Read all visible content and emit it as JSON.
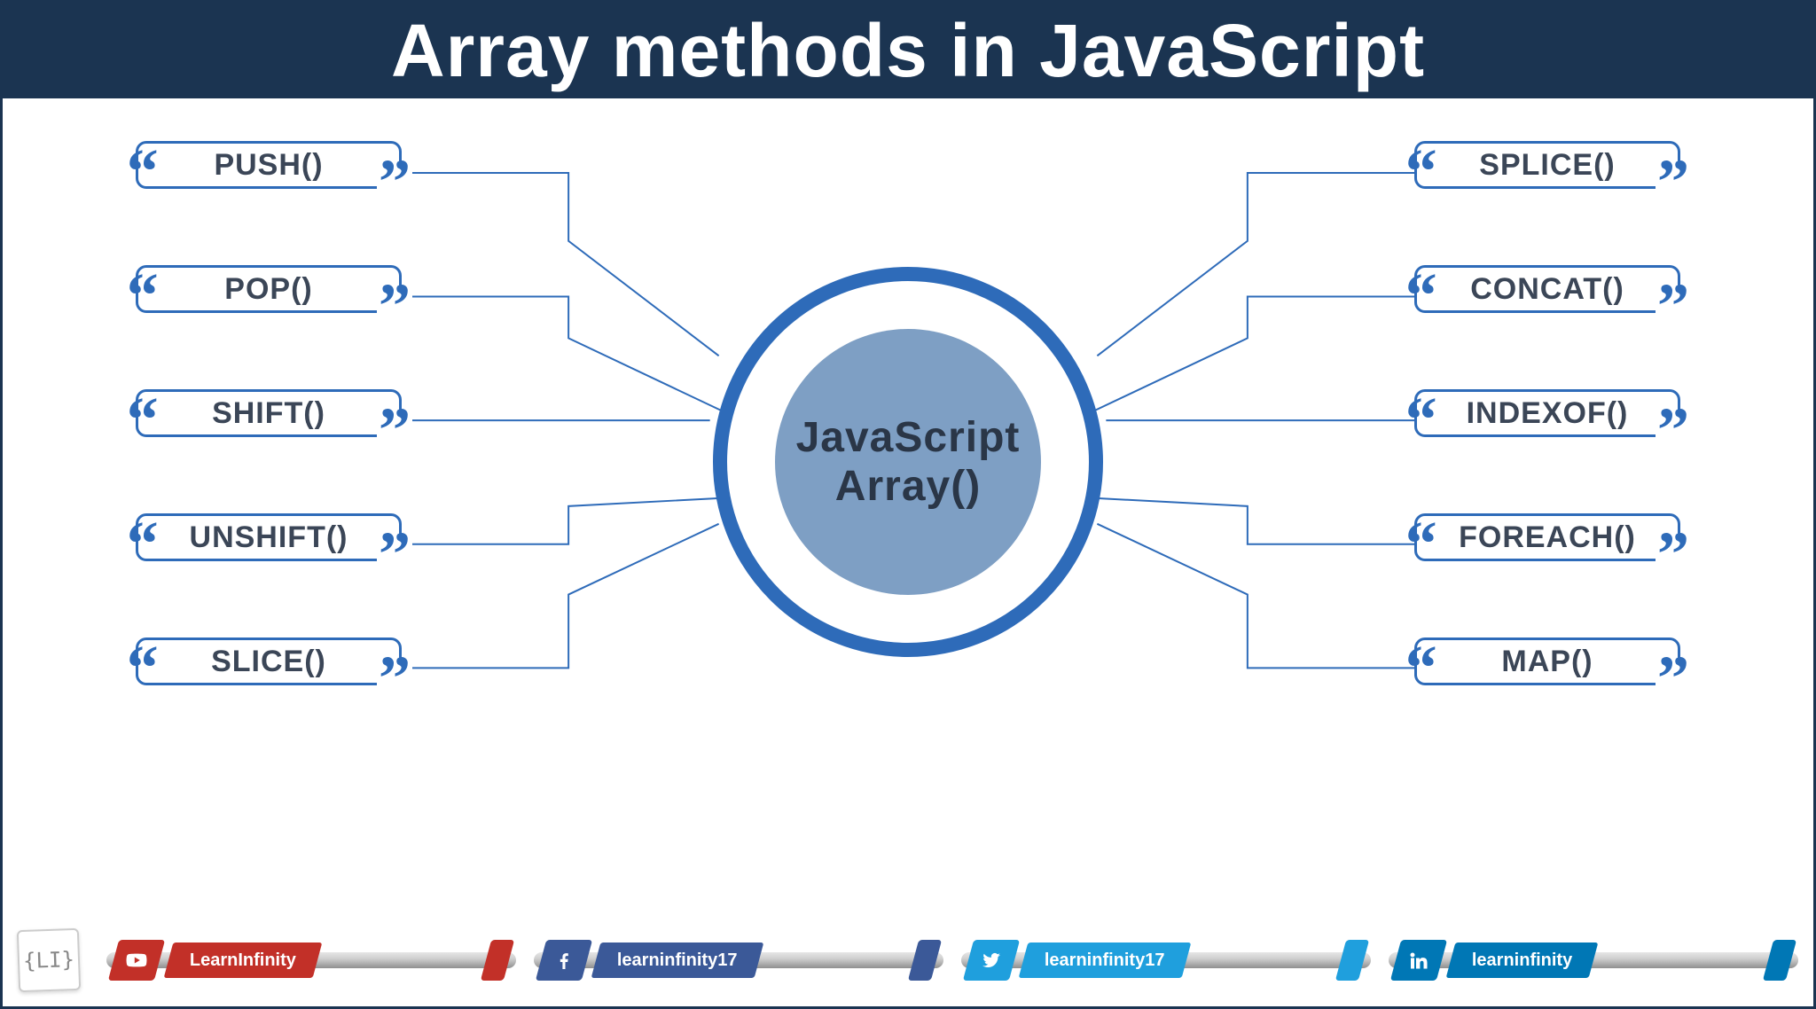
{
  "header": {
    "title": "Array methods in JavaScript"
  },
  "hub": {
    "line1": "JavaScript",
    "line2": "Array()"
  },
  "methods": {
    "left": [
      "PUSH()",
      "POP()",
      "SHIFT()",
      "UNSHIFT()",
      "SLICE()"
    ],
    "right": [
      "SPLICE()",
      "CONCAT()",
      "INDEXOF()",
      "FOREACH()",
      "MAP()"
    ]
  },
  "logo_text": "{LI}",
  "social": {
    "youtube": {
      "handle": "LearnInfinity"
    },
    "facebook": {
      "handle": "learninfinity17"
    },
    "twitter": {
      "handle": "learninfinity17"
    },
    "linkedin": {
      "handle": "learninfinity"
    }
  }
}
